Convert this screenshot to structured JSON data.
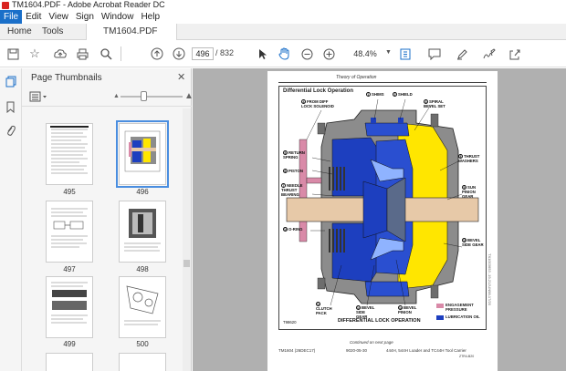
{
  "window": {
    "title": "TM1604.PDF - Adobe Acrobat Reader DC"
  },
  "menu": [
    "File",
    "Edit",
    "View",
    "Sign",
    "Window",
    "Help"
  ],
  "tabs": {
    "home": "Home",
    "tools": "Tools",
    "doc": "TM1604.PDF"
  },
  "toolbar": {
    "current_page": "496",
    "total_pages": "/ 832",
    "zoom": "48.4%"
  },
  "thumbnails_panel": {
    "title": "Page Thumbnails",
    "pages": [
      "495",
      "496",
      "497",
      "498",
      "499",
      "500"
    ],
    "selected": "496"
  },
  "document": {
    "page_header": "Theory of Operation",
    "figure_title": "Differential Lock Operation",
    "caption": "DIFFERENTIAL LOCK OPERATION",
    "figure_id": "T98620",
    "side_id": "TX1003653 -19-21JUN98-17/20",
    "callouts": {
      "shims": "SHIMS",
      "shield": "SHIELD",
      "spiral": "SPIRAL BEVEL SET",
      "from_diff": "FROM DIFF LOCK SOLENOID",
      "return_spring": "RETURN SPRING",
      "piston": "PISTON",
      "needle": "NEEDLE THRUST BEARING",
      "thrust_washers": "THRUST WASHERS",
      "sun_pinion": "SUN PINION GEAR",
      "oring": "O-RING",
      "side_gear": "BEVEL SIDE GEAR",
      "clutch": "CLUTCH PACK",
      "bevel_side": "BEVEL SIDE GEAR",
      "bevel_pinion": "BEVEL PINION"
    },
    "callout_nums": {
      "shims": "1",
      "shield": "2",
      "spiral": "3",
      "from_diff": "4",
      "return_spring": "5",
      "piston": "6",
      "needle": "7",
      "thrust_washers": "8",
      "sun_pinion": "9",
      "oring": "10",
      "side_gear": "11",
      "clutch": "12",
      "bevel_side": "13",
      "bevel_pinion": "14"
    },
    "legend": {
      "engagement": "ENGAGEMENT PRESSURE",
      "lubrication": "LUBRICATION OIL"
    },
    "footer_left": "TM1604 (26DEC17)",
    "footer_mid": "9020-05-30",
    "footer_right": "444H, 544H Loader and TC44H Tool Carrier",
    "footer_sub": "Continued on next page",
    "footer_code": "ZTR4-B20"
  },
  "colors": {
    "accent": "#1a6fc9",
    "blue": "#1d3fbf",
    "yellow": "#ffe600",
    "pink": "#d98aa8",
    "gray": "#8c8c8c"
  }
}
